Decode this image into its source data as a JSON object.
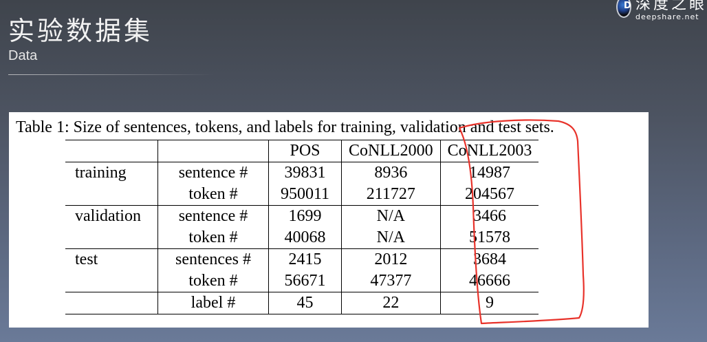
{
  "slide": {
    "title": "实验数据集",
    "subtitle": "Data"
  },
  "logo": {
    "cn": "深度之眼",
    "en": "deepshare.net"
  },
  "table": {
    "caption": "Table 1: Size of sentences, tokens, and labels for training, validation and test sets.",
    "columns": [
      "",
      "",
      "POS",
      "CoNLL2000",
      "CoNLL2003"
    ],
    "rows": [
      {
        "group": "training",
        "label": "sentence #",
        "values": [
          "39831",
          "8936",
          "14987"
        ]
      },
      {
        "group": "",
        "label": "token #",
        "values": [
          "950011",
          "211727",
          "204567"
        ]
      },
      {
        "group": "validation",
        "label": "sentence #",
        "values": [
          "1699",
          "N/A",
          "3466"
        ]
      },
      {
        "group": "",
        "label": "token #",
        "values": [
          "40068",
          "N/A",
          "51578"
        ]
      },
      {
        "group": "test",
        "label": "sentences #",
        "values": [
          "2415",
          "2012",
          "3684"
        ]
      },
      {
        "group": "",
        "label": "token #",
        "values": [
          "56671",
          "47377",
          "46666"
        ]
      },
      {
        "group": "",
        "label": "label #",
        "values": [
          "45",
          "22",
          "9"
        ]
      }
    ]
  },
  "annotation": {
    "color": "#e8322a",
    "highlighted_column": "CoNLL2003"
  }
}
